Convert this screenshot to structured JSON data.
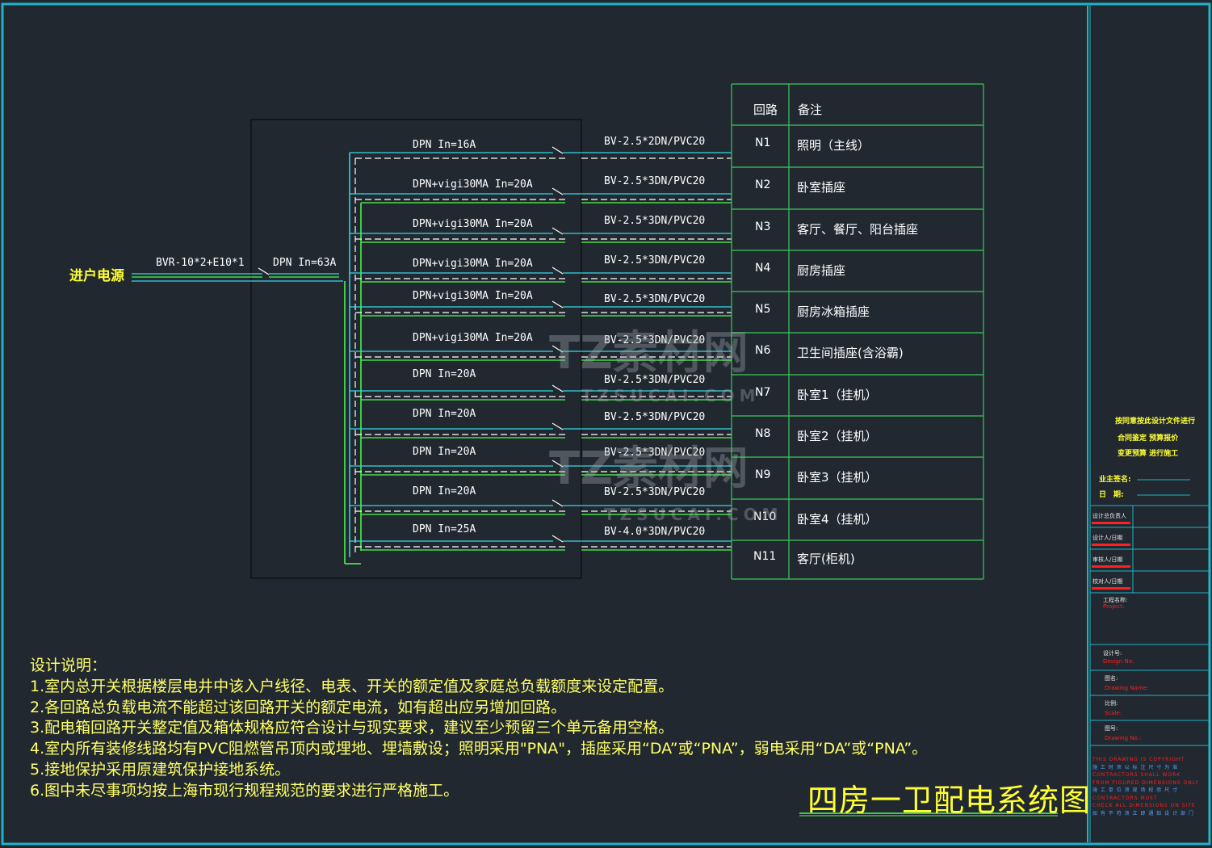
{
  "drawing": {
    "title": "四房一卫配电系统图",
    "incoming": {
      "label": "进户电源",
      "cable": "BVR-10*2+E10*1",
      "main_breaker": "DPN In=63A"
    },
    "table_header": {
      "circuit": "回路",
      "remark": "备注"
    },
    "circuits": [
      {
        "breaker": "DPN In=16A",
        "cable": "BV-2.5*2DN/PVC20",
        "id": "N1",
        "remark": "照明（主线）"
      },
      {
        "breaker": "DPN+vigi30MA In=20A",
        "cable": "BV-2.5*3DN/PVC20",
        "id": "N2",
        "remark": "卧室插座"
      },
      {
        "breaker": "DPN+vigi30MA In=20A",
        "cable": "BV-2.5*3DN/PVC20",
        "id": "N3",
        "remark": "客厅、餐厅、阳台插座"
      },
      {
        "breaker": "DPN+vigi30MA In=20A",
        "cable": "BV-2.5*3DN/PVC20",
        "id": "N4",
        "remark": "厨房插座"
      },
      {
        "breaker": "DPN+vigi30MA In=20A",
        "cable": "BV-2.5*3DN/PVC20",
        "id": "N5",
        "remark": "厨房冰箱插座"
      },
      {
        "breaker": "DPN+vigi30MA In=20A",
        "cable": "BV-2.5*3DN/PVC20",
        "id": "N6",
        "remark": "卫生间插座(含浴霸)"
      },
      {
        "breaker": "DPN In=20A",
        "cable": "BV-2.5*3DN/PVC20",
        "id": "N7",
        "remark": "卧室1（挂机）"
      },
      {
        "breaker": "DPN In=20A",
        "cable": "BV-2.5*3DN/PVC20",
        "id": "N8",
        "remark": "卧室2（挂机）"
      },
      {
        "breaker": "DPN In=20A",
        "cable": "BV-2.5*3DN/PVC20",
        "id": "N9",
        "remark": "卧室3（挂机）"
      },
      {
        "breaker": "DPN In=20A",
        "cable": "BV-2.5*3DN/PVC20",
        "id": "N10",
        "remark": "卧室4（挂机）"
      },
      {
        "breaker": "DPN In=25A",
        "cable": "BV-4.0*3DN/PVC20",
        "id": "N11",
        "remark": "客厅(柜机)"
      }
    ]
  },
  "notes": {
    "heading": "设计说明：",
    "items": [
      "1.室内总开关根据楼层电井中该入户线径、电表、开关的额定值及家庭总负载额度来设定配置。",
      "2.各回路总负载电流不能超过该回路开关的额定电流，如有超出应另增加回路。",
      "3.配电箱回路开关整定值及箱体规格应符合设计与现实要求，建议至少预留三个单元备用空格。",
      "4.室内所有装修线路均有PVC阻燃管吊顶内或埋地、埋墙敷设；照明采用\"PNA\"，插座采用“DA”或“PNA”，弱电采用“DA”或“PNA”。",
      "5.接地保护采用原建筑保护接地系统。",
      "6.图中未尽事项均按上海市现行规程规范的要求进行严格施工。"
    ]
  },
  "title_block": {
    "stamp": [
      "按同意按此设计文件进行",
      "合同鉴定 预算报价",
      "变更预算 进行施工"
    ],
    "owner_sign": "业主签名:",
    "date": "日　期:",
    "roles": [
      "设计总负责人",
      "设计人/日期",
      "审核人/日期",
      "校对人/日期"
    ],
    "project_cn": "工程名称:",
    "project_en": "Project:",
    "design_no_cn": "设计号:",
    "design_no_en": "Design No:",
    "drawing_name_cn": "图名:",
    "drawing_name_en": "Drawing Name:",
    "scale_cn": "比例:",
    "scale_en": "Scale:",
    "drawing_no_cn": "图号:",
    "drawing_no_en": "Drawing No.:",
    "copyright": [
      "THIS DRAWING IS COPYRIGHT",
      "施 工 时 须 以 标 注 尺 寸 为 准",
      "CONTRACTORS SHALL WORK",
      "FROM FIGURED DIMENSIONS ONLY",
      "施 工 单 位 须 现 场 校 验 尺 寸",
      "CONTRACTORS MUST",
      "CHECK ALL DIMENSIONS ON SITE",
      "如 有 不 符 须 立 即 通 知 设 计 部 门"
    ]
  },
  "watermark": {
    "text": "TZ素材网",
    "sub": "TZSUCAI.COM"
  },
  "colors": {
    "background": "#212830",
    "frame": "#1fb4c8",
    "busbar_cyan": "#35d8e8",
    "busbar_green": "#4cff4c",
    "table_grid": "#3cc85a",
    "label_white": "#ffffff",
    "notes_yellow": "#ffff66"
  }
}
